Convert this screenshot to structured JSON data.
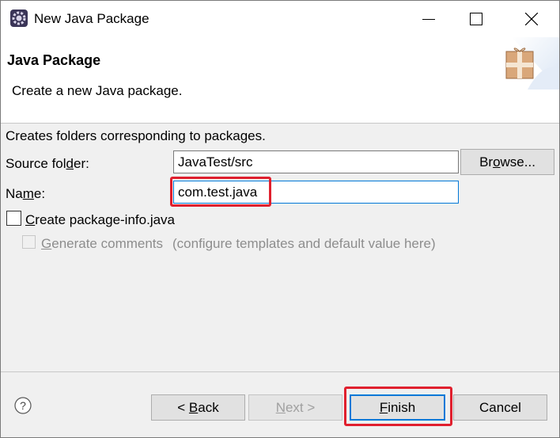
{
  "window": {
    "title": "New Java Package",
    "icons": {
      "app": "eclipse-gear-icon",
      "minimize": "minimize-icon",
      "maximize": "maximize-icon",
      "close": "close-icon"
    }
  },
  "header": {
    "title": "Java Package",
    "description": "Create a new Java package.",
    "icon": "package-wizard-icon"
  },
  "form": {
    "description": "Creates folders corresponding to packages.",
    "source_folder": {
      "label_pre": "Source fol",
      "label_u": "d",
      "label_post": "er:",
      "value": "JavaTest/src"
    },
    "browse": {
      "label_pre": "Br",
      "label_u": "o",
      "label_post": "wse..."
    },
    "name": {
      "label_pre": "Na",
      "label_u": "m",
      "label_post": "e:",
      "value": "com.test.java"
    },
    "create_package_info": {
      "label_u": "C",
      "label_post": "reate package-info.java",
      "checked": false
    },
    "generate_comments": {
      "label_u": "G",
      "label_post": "enerate comments",
      "link_text": "(configure templates and default value here)",
      "checked": false,
      "enabled": false
    }
  },
  "footer": {
    "help_icon": "help-icon",
    "back": {
      "label_pre": "< ",
      "label_u": "B",
      "label_post": "ack"
    },
    "next": {
      "label_u": "N",
      "label_post": "ext >",
      "enabled": false
    },
    "finish": {
      "label_u": "F",
      "label_post": "inish"
    },
    "cancel": {
      "label": "Cancel"
    }
  },
  "colors": {
    "highlight": "#e0202e",
    "focus": "#0078d7"
  }
}
